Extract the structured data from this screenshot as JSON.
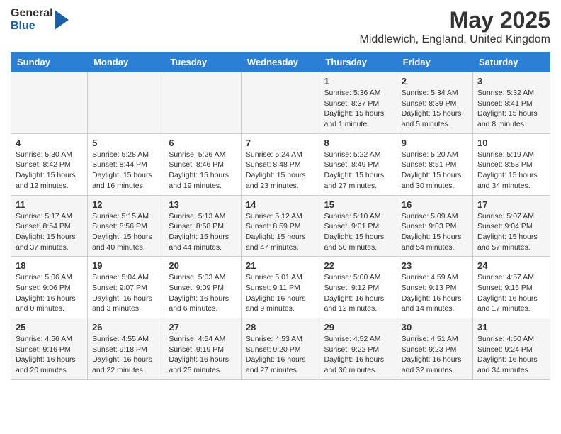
{
  "header": {
    "logo_general": "General",
    "logo_blue": "Blue",
    "month_title": "May 2025",
    "subtitle": "Middlewich, England, United Kingdom"
  },
  "days_of_week": [
    "Sunday",
    "Monday",
    "Tuesday",
    "Wednesday",
    "Thursday",
    "Friday",
    "Saturday"
  ],
  "weeks": [
    [
      {
        "day": "",
        "info": ""
      },
      {
        "day": "",
        "info": ""
      },
      {
        "day": "",
        "info": ""
      },
      {
        "day": "",
        "info": ""
      },
      {
        "day": "1",
        "info": "Sunrise: 5:36 AM\nSunset: 8:37 PM\nDaylight: 15 hours\nand 1 minute."
      },
      {
        "day": "2",
        "info": "Sunrise: 5:34 AM\nSunset: 8:39 PM\nDaylight: 15 hours\nand 5 minutes."
      },
      {
        "day": "3",
        "info": "Sunrise: 5:32 AM\nSunset: 8:41 PM\nDaylight: 15 hours\nand 8 minutes."
      }
    ],
    [
      {
        "day": "4",
        "info": "Sunrise: 5:30 AM\nSunset: 8:42 PM\nDaylight: 15 hours\nand 12 minutes."
      },
      {
        "day": "5",
        "info": "Sunrise: 5:28 AM\nSunset: 8:44 PM\nDaylight: 15 hours\nand 16 minutes."
      },
      {
        "day": "6",
        "info": "Sunrise: 5:26 AM\nSunset: 8:46 PM\nDaylight: 15 hours\nand 19 minutes."
      },
      {
        "day": "7",
        "info": "Sunrise: 5:24 AM\nSunset: 8:48 PM\nDaylight: 15 hours\nand 23 minutes."
      },
      {
        "day": "8",
        "info": "Sunrise: 5:22 AM\nSunset: 8:49 PM\nDaylight: 15 hours\nand 27 minutes."
      },
      {
        "day": "9",
        "info": "Sunrise: 5:20 AM\nSunset: 8:51 PM\nDaylight: 15 hours\nand 30 minutes."
      },
      {
        "day": "10",
        "info": "Sunrise: 5:19 AM\nSunset: 8:53 PM\nDaylight: 15 hours\nand 34 minutes."
      }
    ],
    [
      {
        "day": "11",
        "info": "Sunrise: 5:17 AM\nSunset: 8:54 PM\nDaylight: 15 hours\nand 37 minutes."
      },
      {
        "day": "12",
        "info": "Sunrise: 5:15 AM\nSunset: 8:56 PM\nDaylight: 15 hours\nand 40 minutes."
      },
      {
        "day": "13",
        "info": "Sunrise: 5:13 AM\nSunset: 8:58 PM\nDaylight: 15 hours\nand 44 minutes."
      },
      {
        "day": "14",
        "info": "Sunrise: 5:12 AM\nSunset: 8:59 PM\nDaylight: 15 hours\nand 47 minutes."
      },
      {
        "day": "15",
        "info": "Sunrise: 5:10 AM\nSunset: 9:01 PM\nDaylight: 15 hours\nand 50 minutes."
      },
      {
        "day": "16",
        "info": "Sunrise: 5:09 AM\nSunset: 9:03 PM\nDaylight: 15 hours\nand 54 minutes."
      },
      {
        "day": "17",
        "info": "Sunrise: 5:07 AM\nSunset: 9:04 PM\nDaylight: 15 hours\nand 57 minutes."
      }
    ],
    [
      {
        "day": "18",
        "info": "Sunrise: 5:06 AM\nSunset: 9:06 PM\nDaylight: 16 hours\nand 0 minutes."
      },
      {
        "day": "19",
        "info": "Sunrise: 5:04 AM\nSunset: 9:07 PM\nDaylight: 16 hours\nand 3 minutes."
      },
      {
        "day": "20",
        "info": "Sunrise: 5:03 AM\nSunset: 9:09 PM\nDaylight: 16 hours\nand 6 minutes."
      },
      {
        "day": "21",
        "info": "Sunrise: 5:01 AM\nSunset: 9:11 PM\nDaylight: 16 hours\nand 9 minutes."
      },
      {
        "day": "22",
        "info": "Sunrise: 5:00 AM\nSunset: 9:12 PM\nDaylight: 16 hours\nand 12 minutes."
      },
      {
        "day": "23",
        "info": "Sunrise: 4:59 AM\nSunset: 9:13 PM\nDaylight: 16 hours\nand 14 minutes."
      },
      {
        "day": "24",
        "info": "Sunrise: 4:57 AM\nSunset: 9:15 PM\nDaylight: 16 hours\nand 17 minutes."
      }
    ],
    [
      {
        "day": "25",
        "info": "Sunrise: 4:56 AM\nSunset: 9:16 PM\nDaylight: 16 hours\nand 20 minutes."
      },
      {
        "day": "26",
        "info": "Sunrise: 4:55 AM\nSunset: 9:18 PM\nDaylight: 16 hours\nand 22 minutes."
      },
      {
        "day": "27",
        "info": "Sunrise: 4:54 AM\nSunset: 9:19 PM\nDaylight: 16 hours\nand 25 minutes."
      },
      {
        "day": "28",
        "info": "Sunrise: 4:53 AM\nSunset: 9:20 PM\nDaylight: 16 hours\nand 27 minutes."
      },
      {
        "day": "29",
        "info": "Sunrise: 4:52 AM\nSunset: 9:22 PM\nDaylight: 16 hours\nand 30 minutes."
      },
      {
        "day": "30",
        "info": "Sunrise: 4:51 AM\nSunset: 9:23 PM\nDaylight: 16 hours\nand 32 minutes."
      },
      {
        "day": "31",
        "info": "Sunrise: 4:50 AM\nSunset: 9:24 PM\nDaylight: 16 hours\nand 34 minutes."
      }
    ]
  ]
}
